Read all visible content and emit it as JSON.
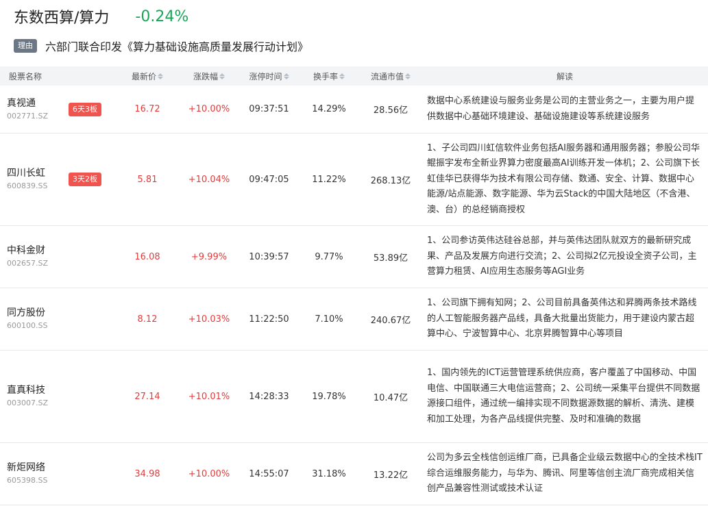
{
  "header": {
    "title": "东数西算/算力",
    "change": "-0.24%"
  },
  "reason": {
    "tag": "理由",
    "text": "六部门联合印发《算力基础设施高质量发展行动计划》"
  },
  "table": {
    "columns": {
      "name": "股票名称",
      "price": "最新价",
      "pct": "涨跌幅",
      "time": "涨停时间",
      "turnover": "换手率",
      "cap": "流通市值",
      "desc": "解读"
    },
    "rows": [
      {
        "name": "真视通",
        "code": "002771.SZ",
        "badge": "6天3板",
        "price": "16.72",
        "pct": "+10.00%",
        "time": "09:37:51",
        "turnover": "14.29%",
        "cap": "28.56亿",
        "desc": "数据中心系统建设与服务业务是公司的主营业务之一，主要为用户提供数据中心基础环境建设、基础设施建设等系统建设服务"
      },
      {
        "name": "四川长虹",
        "code": "600839.SS",
        "badge": "3天2板",
        "price": "5.81",
        "pct": "+10.04%",
        "time": "09:47:05",
        "turnover": "11.22%",
        "cap": "268.13亿",
        "desc": "1、子公司四川虹信软件业务包括AI服务器和通用服务器；参股公司华鲲振宇发布全新业界算力密度最高AI训练开发一体机；2、公司旗下长虹佳华已获得华为技术有限公司存储、数通、安全、计算、数据中心能源/站点能源、数字能源、华为云Stack的中国大陆地区（不含港、澳、台）的总经销商授权"
      },
      {
        "name": "中科金财",
        "code": "002657.SZ",
        "badge": "",
        "price": "16.08",
        "pct": "+9.99%",
        "time": "10:39:57",
        "turnover": "9.77%",
        "cap": "53.89亿",
        "desc": "1、公司参访英伟达硅谷总部，并与英伟达团队就双方的最新研究成果、产品及发展方向进行交流；2、公司拟2亿元投设全资子公司，主营算力租赁、AI应用生态服务等AGI业务"
      },
      {
        "name": "同方股份",
        "code": "600100.SS",
        "badge": "",
        "price": "8.12",
        "pct": "+10.03%",
        "time": "11:22:50",
        "turnover": "7.10%",
        "cap": "240.67亿",
        "desc": "1、公司旗下拥有知网；2、公司目前具备英伟达和昇腾两条技术路线的人工智能服务器产品线，具备大批量出货能力，用于建设内蒙古超算中心、宁波智算中心、北京昇腾智算中心等项目"
      },
      {
        "name": "直真科技",
        "code": "003007.SZ",
        "badge": "",
        "price": "27.14",
        "pct": "+10.01%",
        "time": "14:28:33",
        "turnover": "19.78%",
        "cap": "10.47亿",
        "desc": "1、国内领先的ICT运营管理系统供应商，客户覆盖了中国移动、中国电信、中国联通三大电信运营商；2、公司统一采集平台提供不同数据源接口组件，通过统一编排实现不同数据源数据的解析、清洗、建模和加工处理，为各产品线提供完整、及时和准确的数据"
      },
      {
        "name": "新炬网络",
        "code": "605398.SS",
        "badge": "",
        "price": "34.98",
        "pct": "+10.00%",
        "time": "14:55:07",
        "turnover": "31.18%",
        "cap": "13.22亿",
        "desc": "公司为多云全栈信创运维厂商，已具备企业级云数据中心的全技术栈IT综合运维服务能力，与华为、腾讯、阿里等信创主流厂商完成相关信创产品兼容性测试或技术认证"
      }
    ]
  }
}
